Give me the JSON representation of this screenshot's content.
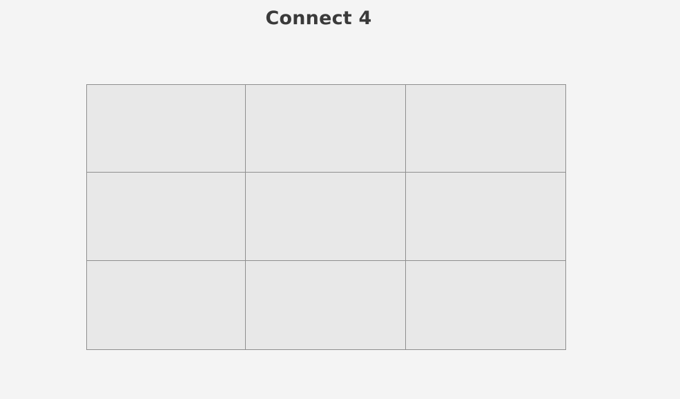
{
  "title": "Connect 4",
  "colors": {
    "background": "#f4f4f4",
    "cell_fill": "#e8e8e8",
    "cell_border": "#8e8e8e",
    "title_text": "#3a3a3a"
  },
  "board": {
    "rows": 3,
    "columns": 3,
    "cells": [
      [
        "",
        "",
        ""
      ],
      [
        "",
        "",
        ""
      ],
      [
        "",
        "",
        ""
      ]
    ]
  }
}
